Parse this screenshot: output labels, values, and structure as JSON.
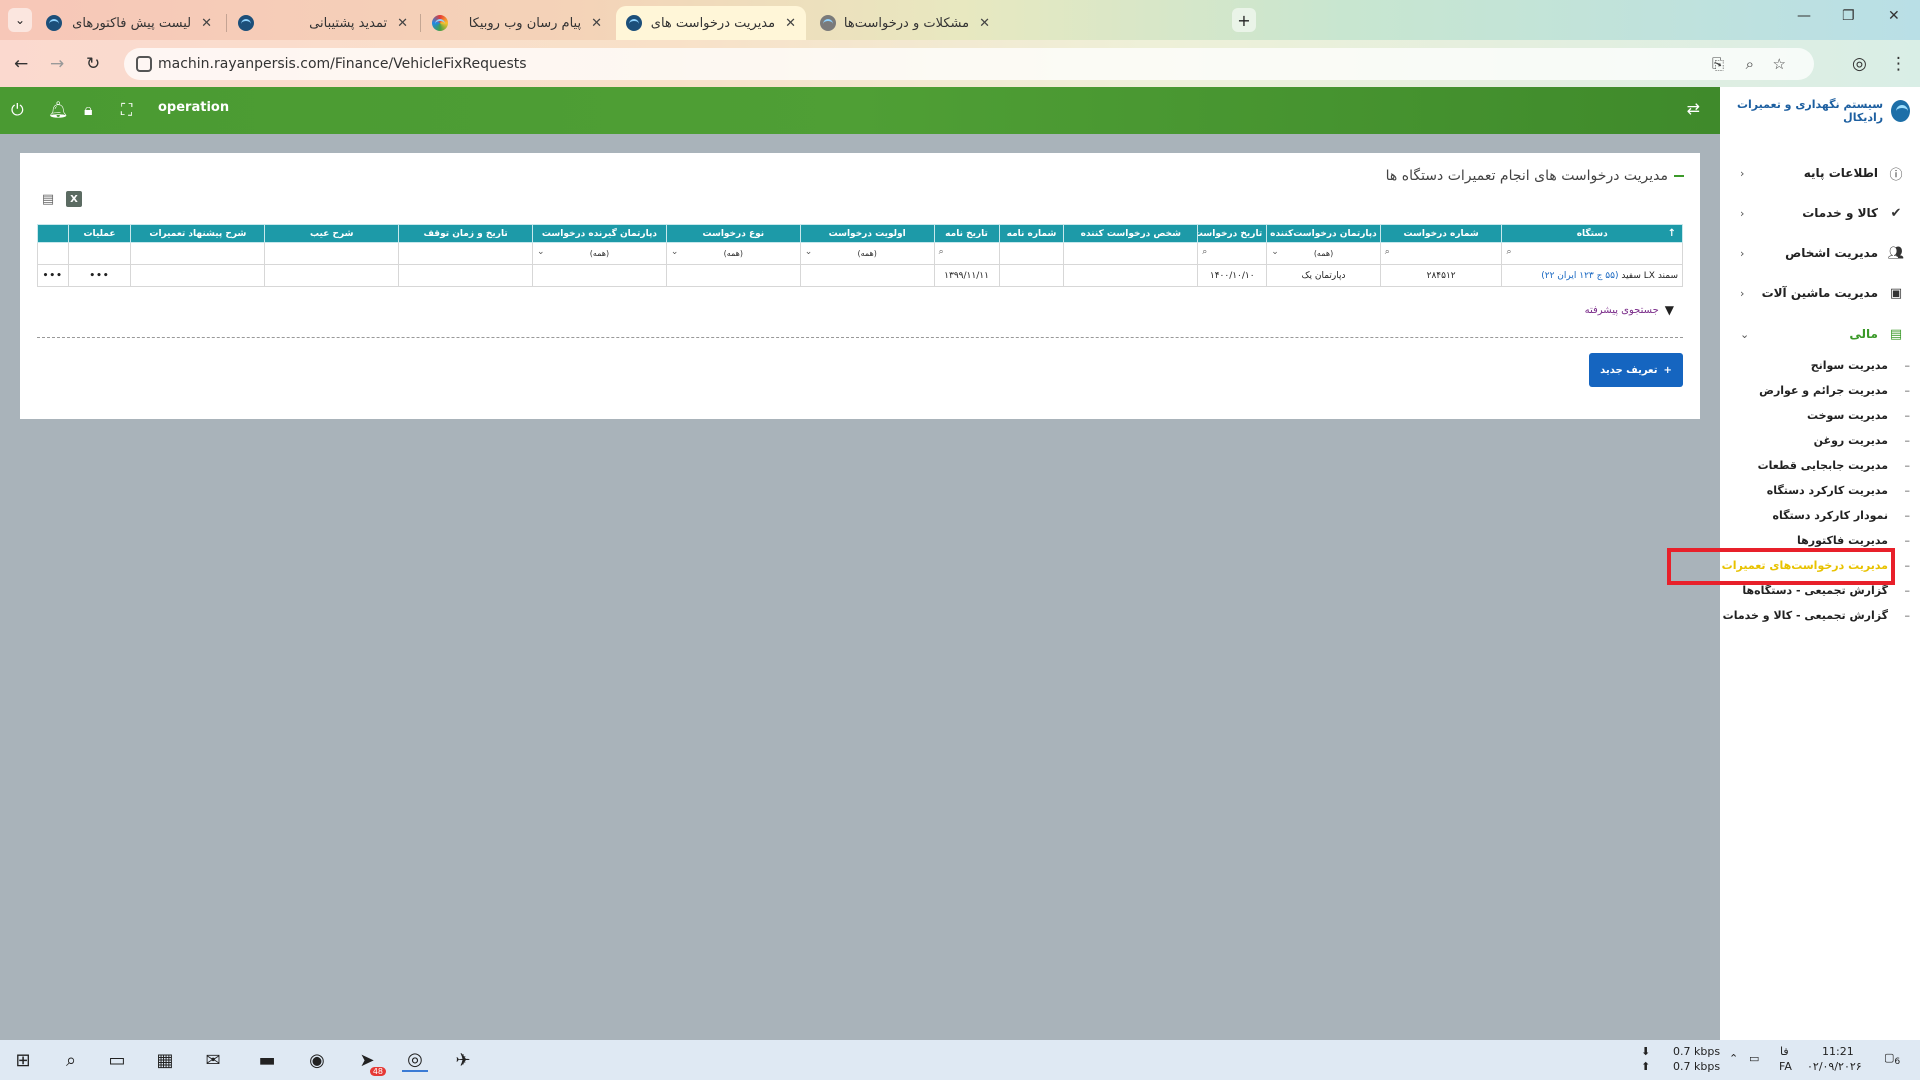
{
  "browser": {
    "tabs": [
      {
        "title": "لیست پیش فاکتورهای فروش",
        "icon": "rayanpersis-favicon",
        "active": false
      },
      {
        "title": "تمدید پشتیبانی",
        "icon": "rayanpersis-favicon",
        "active": false
      },
      {
        "title": "پیام رسان وب روبیکا",
        "icon": "rubika-favicon",
        "active": false
      },
      {
        "title": "مدیریت درخواست های انجام تعم...",
        "icon": "rayanpersis-favicon",
        "active": true
      },
      {
        "title": "مشکلات و درخواست‌ها - ŒÛ¤Ø",
        "icon": "globe-favicon",
        "active": false
      }
    ],
    "url": "machin.rayanpersis.com/Finance/VehicleFixRequests"
  },
  "header": {
    "user": "operation"
  },
  "sidebar": {
    "brand": "سیستم نگهداری و تعمیرات رادیکال",
    "menu": [
      {
        "label": "اطلاعات پایه",
        "icon": "info-icon"
      },
      {
        "label": "کالا و خدمات",
        "icon": "check-icon"
      },
      {
        "label": "مدیریت اشخاص",
        "icon": "people-icon"
      },
      {
        "label": "مدیریت ماشین آلات",
        "icon": "bus-icon"
      },
      {
        "label": "مالی",
        "icon": "money-icon"
      }
    ],
    "submenu": [
      "مدیریت سوانح",
      "مدیریت جرائم و عوارض",
      "مدیریت سوخت",
      "مدیریت روغن",
      "مدیریت جابجایی قطعات",
      "مدیریت کارکرد دستگاه",
      "نمودار کارکرد دستگاه",
      "مدیریت فاکتورها",
      "مدیریت درخواست‌های تعمیرات",
      "گزارش تجمیعی - دستگاه‌ها",
      "گزارش تجمیعی - کالا و خدمات"
    ],
    "active_submenu": "مدیریت درخواست‌های تعمیرات"
  },
  "page": {
    "title": "مدیریت درخواست های انجام تعمیرات دستگاه ها",
    "advanced_search": "جستجوی پیشرفته",
    "new_button": "تعریف جدید",
    "excel_label": "X"
  },
  "grid": {
    "columns": [
      "دستگاه",
      "شماره درخواست",
      "دپارتمان درخواست‌کننده",
      "تاریخ درخواست",
      "شخص درخواست کننده",
      "شماره نامه",
      "تاریخ نامه",
      "اولویت درخواست",
      "نوع درخواست",
      "دپارتمان گیرنده درخواست",
      "تاریخ و زمان توقف",
      "شرح عیب",
      "شرح پیشنهاد تعمیرات",
      "عملیات"
    ],
    "filter_all": "(همه)",
    "row": {
      "device_name": "سمند LX سفید",
      "device_plate": "(۵۵ ج ۱۲۳ ایران ۲۲)",
      "request_no": "۲۸۴۵۱۲",
      "department": "دپارتمان یک",
      "request_date": "۱۴۰۰/۱۰/۱۰",
      "requester": "",
      "letter_no": "",
      "letter_date": "۱۳۹۹/۱۱/۱۱",
      "priority": "",
      "type": "",
      "receiver_department": "",
      "stop_datetime": "",
      "fault_description": "",
      "repair_suggestion": "",
      "ops": "•••",
      "menu": "•••"
    }
  },
  "taskbar": {
    "telegram_badge": "48",
    "net_down": "0.7 kbps",
    "net_up": "0.7 kbps",
    "lang": "فا",
    "lang2": "FA",
    "time": "11:21",
    "date": "۰۲/۰۹/۲۰۲۶",
    "notif_count": "6"
  },
  "colors": {
    "header_green": "#4a9a32",
    "grid_header": "#1d9aa8",
    "primary_button": "#1565c0",
    "active_menu": "#e8c200",
    "highlight_box": "#e8202a"
  }
}
